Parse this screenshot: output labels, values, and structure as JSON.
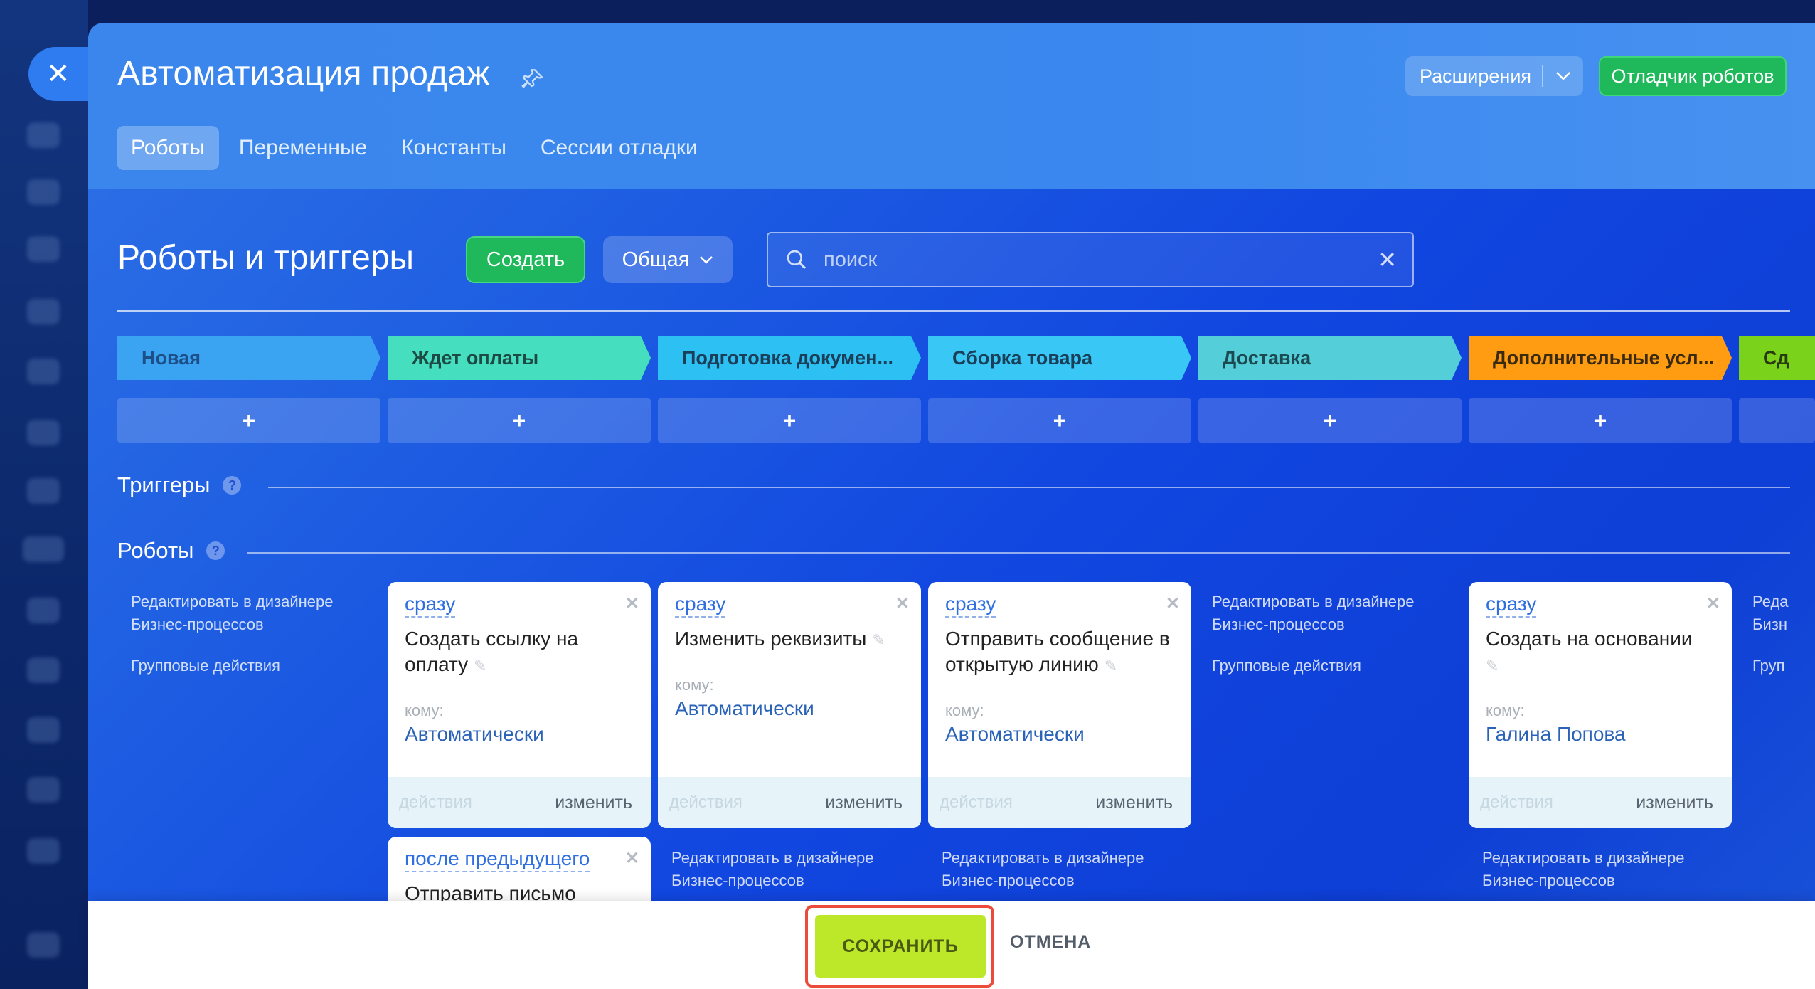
{
  "header": {
    "title": "Автоматизация продаж",
    "extensions_label": "Расширения",
    "debugger_label": "Отладчик роботов",
    "tabs": [
      {
        "label": "Роботы",
        "active": true
      },
      {
        "label": "Переменные",
        "active": false
      },
      {
        "label": "Константы",
        "active": false
      },
      {
        "label": "Сессии отладки",
        "active": false
      }
    ]
  },
  "toolbar": {
    "section_title": "Роботы и триггеры",
    "create_label": "Создать",
    "scope_label": "Общая",
    "search_placeholder": "поиск"
  },
  "stages": [
    {
      "label": "Новая",
      "color": "#3aa3f2"
    },
    {
      "label": "Ждет оплаты",
      "color": "#45dfc0"
    },
    {
      "label": "Подготовка докумен...",
      "color": "#2cc0f3"
    },
    {
      "label": "Сборка товара",
      "color": "#39c8f6"
    },
    {
      "label": "Доставка",
      "color": "#54cfda"
    },
    {
      "label": "Дополнительные усл...",
      "color": "#ff9c12"
    },
    {
      "label": "Сд",
      "color": "#7ad31a"
    }
  ],
  "add_label": "+",
  "sections": {
    "triggers": "Триггеры",
    "robots": "Роботы",
    "help": "?"
  },
  "column_links": {
    "edit_in_designer": "Редактировать в дизайнере Бизнес-процессов",
    "group_actions": "Групповые действия",
    "edit_partial": "Реда Бизн",
    "group_partial": "Груп"
  },
  "robot_cards": [
    {
      "when": "сразу",
      "name": "Создать ссылку на оплату",
      "to_label": "кому:",
      "to_value": "Автоматически",
      "actions": "действия",
      "edit": "изменить"
    },
    {
      "when": "сразу",
      "name": "Изменить реквизиты",
      "to_label": "кому:",
      "to_value": "Автоматически",
      "actions": "действия",
      "edit": "изменить"
    },
    {
      "when": "сразу",
      "name": "Отправить сообщение в открытую линию",
      "to_label": "кому:",
      "to_value": "Автоматически",
      "actions": "действия",
      "edit": "изменить"
    },
    {
      "when": "сразу",
      "name": "Создать на основании",
      "to_label": "кому:",
      "to_value": "Галина Попова",
      "actions": "действия",
      "edit": "изменить"
    }
  ],
  "second_row_card": {
    "when": "после предыдущего",
    "name": "Отправить письмо"
  },
  "footer": {
    "save_label": "СОХРАНИТЬ",
    "cancel_label": "ОТМЕНА"
  }
}
